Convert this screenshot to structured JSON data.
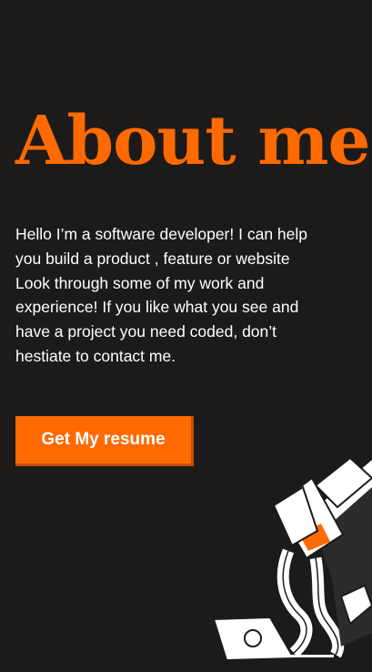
{
  "hero": {
    "title": "About me",
    "intro_lines": [
      "Hello I’m a software developer! I can help",
      "you build a product , feature or website",
      "Look through some of my work and",
      "experience! If you like what you see and",
      "have a project you need coded, don’t",
      "hestiate to contact me."
    ],
    "resume_button_label": "Get My resume"
  },
  "colors": {
    "background": "#1c1b1a",
    "accent": "#ff6a00",
    "text": "#ffffff"
  },
  "illustration": {
    "icon": "developer-at-laptop-illustration"
  }
}
